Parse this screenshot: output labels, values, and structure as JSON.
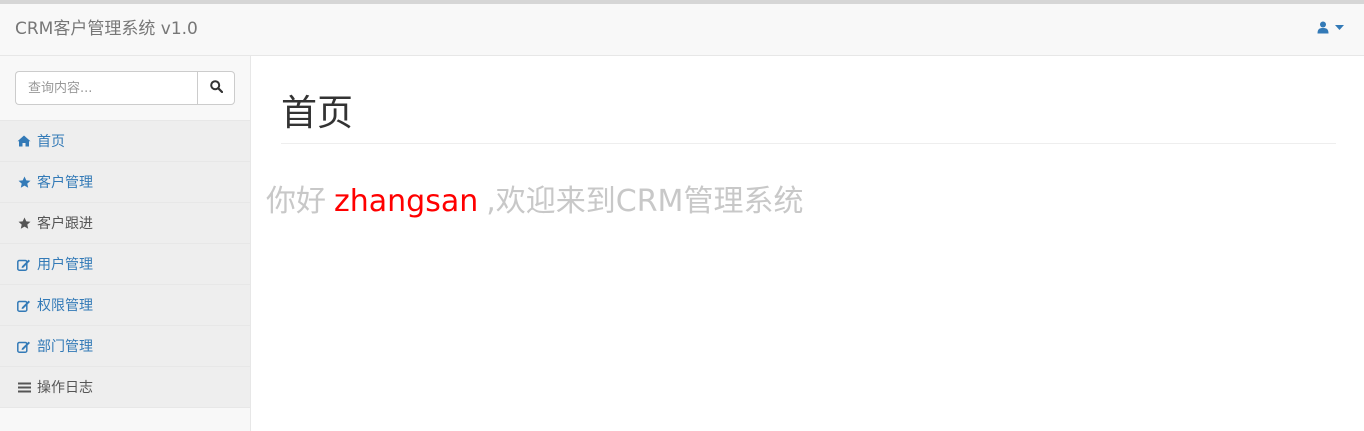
{
  "navbar": {
    "brand": "CRM客户管理系统 v1.0",
    "user_icon": "user-icon",
    "caret_icon": "caret-down-icon"
  },
  "sidebar": {
    "search": {
      "placeholder": "查询内容...",
      "button_icon": "search-icon"
    },
    "items": [
      {
        "label": "首页",
        "icon": "home-icon"
      },
      {
        "label": "客户管理",
        "icon": "star-icon"
      },
      {
        "label": "客户跟进",
        "icon": "star-icon"
      },
      {
        "label": "用户管理",
        "icon": "edit-icon"
      },
      {
        "label": "权限管理",
        "icon": "edit-icon"
      },
      {
        "label": "部门管理",
        "icon": "edit-icon"
      },
      {
        "label": "操作日志",
        "icon": "list-icon"
      }
    ]
  },
  "main": {
    "title": "首页",
    "welcome": {
      "prefix": "你好",
      "username": "zhangsan",
      "suffix": ",欢迎来到CRM管理系统"
    }
  },
  "colors": {
    "link": "#337ab7",
    "username": "#ff0000",
    "muted_text": "#c8c8c8"
  }
}
